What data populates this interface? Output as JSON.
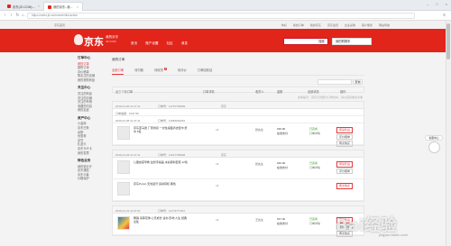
{
  "browser": {
    "tabs": [
      {
        "label": "京东(JD.COM)-...",
        "close": "×"
      },
      {
        "label": "我的京东--我...",
        "close": "×"
      }
    ],
    "window_controls": [
      "–",
      "□",
      "×"
    ],
    "back": "‹",
    "forward": "›",
    "refresh": "↻",
    "home": "⌂",
    "url": "https://order.jd.com/center/list.action",
    "menu": "≡"
  },
  "topbar": {
    "left": "京东首页",
    "links": [
      "你好",
      "我的订单",
      "我的京东",
      "京东会员",
      "企业采购",
      "客户服务",
      "网站导航"
    ]
  },
  "header": {
    "logo": "京东",
    "sub": "我的京东",
    "sub2": "JD.COM",
    "nav": [
      "首页",
      "账户设置",
      "社区",
      "消息"
    ],
    "search_placeholder": "",
    "search_button": "搜索",
    "cart": "我的购物车"
  },
  "sidebar": {
    "groups": [
      {
        "title": "订单中心",
        "items": [
          "我的订单",
          "团购订单",
          "评价晒单",
          "购买过的店铺",
          "我的常购商品"
        ]
      },
      {
        "title": "关注中心",
        "items": [
          "关注的商品",
          "关注的店铺",
          "关注的专辑",
          "收藏的内容",
          "我的足迹"
        ]
      },
      {
        "title": "资产中心",
        "items": [
          "小金库",
          "京东白条",
          "余额",
          "优惠券",
          "京豆",
          "礼品卡",
          "京东卡/E卡",
          "我的发票"
        ]
      },
      {
        "title": "特色业务",
        "items": [
          "我的营业厅",
          "京东通信",
          "京东众筹",
          "价格保护"
        ]
      }
    ],
    "active": "我的订单"
  },
  "main": {
    "crumb": "我的订单",
    "filters": [
      {
        "label": "全部订单",
        "badge": ""
      },
      {
        "label": "待付款",
        "badge": ""
      },
      {
        "label": "待收货",
        "badge": "1"
      },
      {
        "label": "待评价",
        "badge": ""
      },
      {
        "label": "订单回收站",
        "badge": ""
      }
    ],
    "search_button": "查询",
    "columns": [
      "近三个月订单",
      "订单详情",
      "收货人",
      "金额",
      "全部状态",
      "操作"
    ],
    "notice": "友情提示：京东已对部分订单合并，请以实际收货为准",
    "orders": [
      {
        "date": "2016-01-06 11:27:11",
        "no": "订单号：11767769699",
        "shop": "京东",
        "amount_head": "订单金额：¥137.50",
        "sub_date": "2016-01-05 11:47:11",
        "sub_no": "订单号：11684602262",
        "items": [
          {
            "name": "京东亚马逊 厂家供货 一次性桌面清洁湿巾 纸巾 5包",
            "qty": "×1",
            "who": "张先生",
            "amt": "¥36.00",
            "amt2": "在线支付",
            "status": "已完成",
            "status2": "订单详情",
            "ops": [
              "申请售后",
              "评价晒单",
              "再次购买"
            ]
          }
        ]
      },
      {
        "date": "2016-01-03 11:47:11",
        "no": "订单号：11617759968",
        "shop": "京东",
        "amount_head": "",
        "sub_date": "",
        "sub_no": "",
        "items": [
          {
            "name": "儿童启蒙早教 益智手指画 水彩颜料套装 12色",
            "qty": "×1",
            "who": "张先生",
            "amt": "¥40.00",
            "amt2": "在线支付",
            "status": "已完成",
            "status2": "订单详情",
            "ops": [
              "申请售后",
              "评价晒单"
            ]
          },
          {
            "name": "京东Pyson 无线蓝牙 运动耳机 黑色",
            "qty": "×1",
            "who": "",
            "amt": "",
            "amt2": "",
            "status": "",
            "status2": "",
            "ops": [
              "再次购买"
            ]
          }
        ]
      },
      {
        "date": "2016-01-01 11:27:01",
        "no": "订单号：11773777067",
        "shop": "",
        "amount_head": "",
        "sub_date": "",
        "sub_no": "",
        "items": [
          {
            "name": "畅销 墨菲定律 心灵成长 读书 影响 人生 经典 全集",
            "qty": "×1",
            "who": "王先生",
            "amt": "¥47.40",
            "amt2": "在线支付",
            "status": "已完成",
            "status2": "订单详情",
            "ops": [
              "申请售后",
              "评价晒单",
              "再次购买"
            ]
          }
        ]
      }
    ]
  },
  "floating": {
    "help": "客服中心"
  },
  "watermark": "Bai经验",
  "watermark_url": "jingyan.baidu.com",
  "colors": {
    "brand": "#e1251b",
    "accent": "#e4393c",
    "ok": "#3a9d23"
  }
}
